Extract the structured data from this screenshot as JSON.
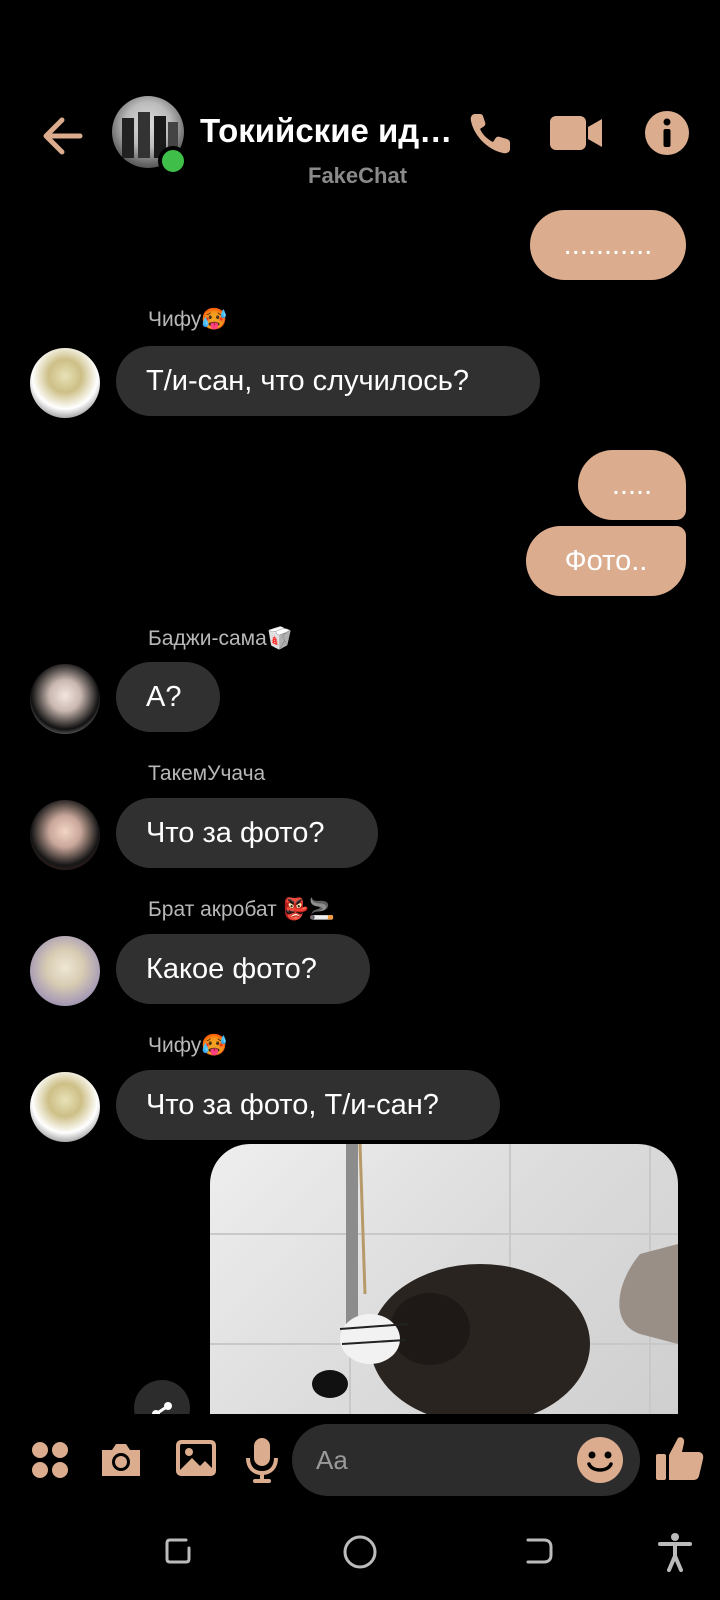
{
  "header": {
    "title": "Токийские ид…",
    "subtitle": "FakeChat",
    "accent_color": "#dbac8e",
    "online_color": "#3fbf4a"
  },
  "messages": [
    {
      "direction": "out",
      "text": "..........."
    },
    {
      "direction": "in",
      "sender": "Чифу🥵",
      "text": "Т/и-сан, что случилось?"
    },
    {
      "direction": "out",
      "text": "....."
    },
    {
      "direction": "out",
      "text": "Фото.."
    },
    {
      "direction": "in",
      "sender": "Баджи-сама🥡",
      "text": "А?"
    },
    {
      "direction": "in",
      "sender": "ТакемУчача",
      "text": "Что за фото?"
    },
    {
      "direction": "in",
      "sender": "Брат акробат 👺🚬",
      "text": "Какое фото?"
    },
    {
      "direction": "in",
      "sender": "Чифу🥵",
      "text": "Что за фото, Т/и-сан?"
    },
    {
      "direction": "out",
      "type": "photo"
    }
  ],
  "composer": {
    "placeholder": "Aa"
  },
  "icons": {
    "back": "arrow-left-icon",
    "call": "phone-icon",
    "video": "video-camera-icon",
    "info": "info-icon",
    "menu": "four-dots-icon",
    "camera": "camera-icon",
    "gallery": "image-icon",
    "mic": "microphone-icon",
    "emoji": "smiley-icon",
    "like": "thumbs-up-icon",
    "share": "share-icon"
  }
}
